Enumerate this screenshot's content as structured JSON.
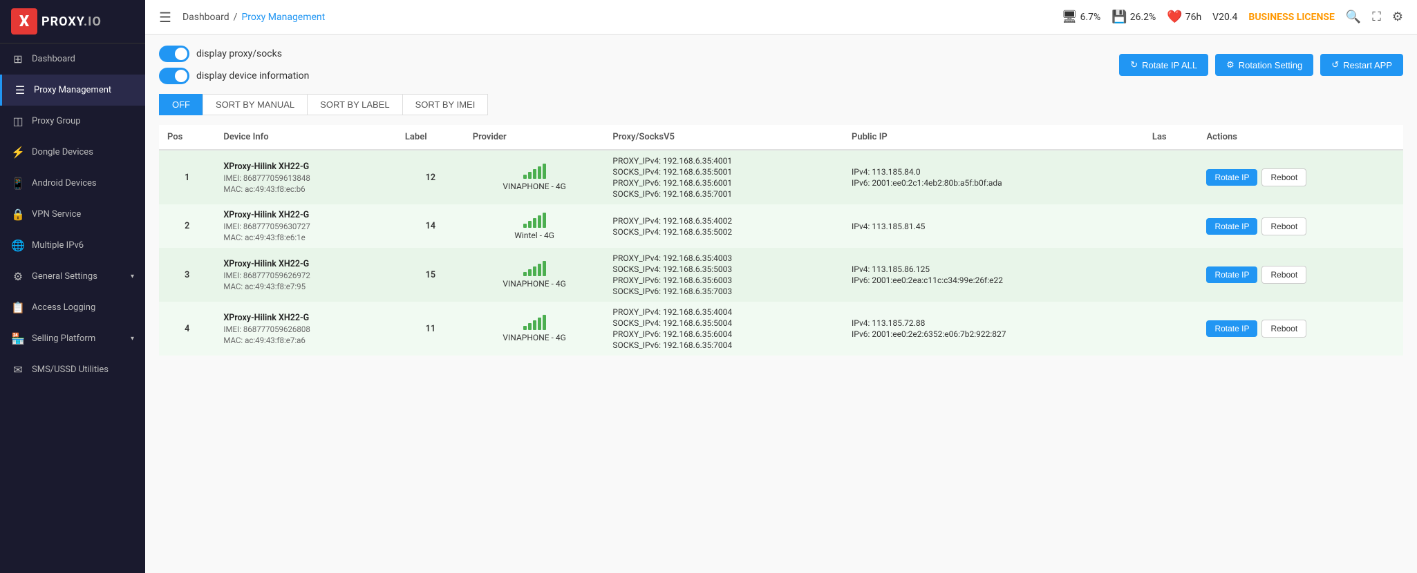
{
  "sidebar": {
    "logo": {
      "letter": "X",
      "text": "PROXY",
      "suffix": ".IO"
    },
    "items": [
      {
        "id": "dashboard",
        "icon": "⊞",
        "label": "Dashboard",
        "active": false
      },
      {
        "id": "proxy-management",
        "icon": "☰",
        "label": "Proxy Management",
        "active": true
      },
      {
        "id": "proxy-group",
        "icon": "◫",
        "label": "Proxy Group",
        "active": false
      },
      {
        "id": "dongle-devices",
        "icon": "⚡",
        "label": "Dongle Devices",
        "active": false
      },
      {
        "id": "android-devices",
        "icon": "📱",
        "label": "Android Devices",
        "active": false
      },
      {
        "id": "vpn-service",
        "icon": "🔒",
        "label": "VPN Service",
        "active": false
      },
      {
        "id": "multiple-ipv6",
        "icon": "🌐",
        "label": "Multiple IPv6",
        "active": false
      },
      {
        "id": "general-settings",
        "icon": "⚙",
        "label": "General Settings",
        "active": false,
        "hasChevron": true
      },
      {
        "id": "access-logging",
        "icon": "📋",
        "label": "Access Logging",
        "active": false
      },
      {
        "id": "selling-platform",
        "icon": "🏪",
        "label": "Selling Platform",
        "active": false,
        "hasChevron": true
      },
      {
        "id": "sms-ussd",
        "icon": "✉",
        "label": "SMS/USSD Utilities",
        "active": false
      }
    ]
  },
  "topbar": {
    "menu_icon": "☰",
    "breadcrumb": {
      "parent": "Dashboard",
      "separator": "/",
      "current": "Proxy Management"
    },
    "stats": {
      "cpu_icon": "🖥",
      "cpu_value": "6.7%",
      "ram_icon": "💾",
      "ram_value": "26.2%",
      "heart_icon": "❤",
      "uptime": "76h",
      "version": "V20.4"
    },
    "license": "BUSINESS LICENSE",
    "icons": {
      "search": "🔍",
      "expand": "⛶",
      "settings": "⚙"
    }
  },
  "controls": {
    "toggle1_label": "display proxy/socks",
    "toggle2_label": "display device information",
    "buttons": {
      "rotate_all": "Rotate IP ALL",
      "rotation_setting": "Rotation Setting",
      "restart_app": "Restart APP"
    }
  },
  "sort_tabs": [
    {
      "id": "off",
      "label": "OFF",
      "active": true
    },
    {
      "id": "manual",
      "label": "SORT BY MANUAL",
      "active": false
    },
    {
      "id": "label",
      "label": "SORT BY LABEL",
      "active": false
    },
    {
      "id": "imei",
      "label": "SORT BY IMEI",
      "active": false
    }
  ],
  "table": {
    "headers": [
      "Pos",
      "Device Info",
      "Label",
      "Provider",
      "Proxy/SocksV5",
      "Public IP",
      "Las",
      "Actions"
    ],
    "rows": [
      {
        "pos": "1",
        "device_name": "XProxy-Hilink XH22-G",
        "imei": "IMEI: 868777059613848",
        "mac": "MAC: ac:49:43:f8:ec:b6",
        "label": "12",
        "provider": "VINAPHONE - 4G",
        "proxies": [
          "PROXY_IPv4: 192.168.6.35:4001",
          "SOCKS_IPv4: 192.168.6.35:5001",
          "PROXY_IPv6: 192.168.6.35:6001",
          "SOCKS_IPv6: 192.168.6.35:7001"
        ],
        "ipv4": "IPv4: 113.185.84.0",
        "ipv6": "IPv6: 2001:ee0:2c1:4eb2:80b:a5f:b0f:ada",
        "btn_rotate": "Rotate IP",
        "btn_reboot": "Reboot"
      },
      {
        "pos": "2",
        "device_name": "XProxy-Hilink XH22-G",
        "imei": "IMEI: 868777059630727",
        "mac": "MAC: ac:49:43:f8:e6:1e",
        "label": "14",
        "provider": "Wintel - 4G",
        "proxies": [
          "PROXY_IPv4: 192.168.6.35:4002",
          "SOCKS_IPv4: 192.168.6.35:5002"
        ],
        "ipv4": "IPv4: 113.185.81.45",
        "ipv6": "",
        "btn_rotate": "Rotate IP",
        "btn_reboot": "Reboot"
      },
      {
        "pos": "3",
        "device_name": "XProxy-Hilink XH22-G",
        "imei": "IMEI: 868777059626972",
        "mac": "MAC: ac:49:43:f8:e7:95",
        "label": "15",
        "provider": "VINAPHONE - 4G",
        "proxies": [
          "PROXY_IPv4: 192.168.6.35:4003",
          "SOCKS_IPv4: 192.168.6.35:5003",
          "PROXY_IPv6: 192.168.6.35:6003",
          "SOCKS_IPv6: 192.168.6.35:7003"
        ],
        "ipv4": "IPv4: 113.185.86.125",
        "ipv6": "IPv6: 2001:ee0:2ea:c11c:c34:99e:26f:e22",
        "btn_rotate": "Rotate IP",
        "btn_reboot": "Reboot"
      },
      {
        "pos": "4",
        "device_name": "XProxy-Hilink XH22-G",
        "imei": "IMEI: 868777059626808",
        "mac": "MAC: ac:49:43:f8:e7:a6",
        "label": "11",
        "provider": "VINAPHONE - 4G",
        "proxies": [
          "PROXY_IPv4: 192.168.6.35:4004",
          "SOCKS_IPv4: 192.168.6.35:5004",
          "PROXY_IPv6: 192.168.6.35:6004",
          "SOCKS_IPv6: 192.168.6.35:7004"
        ],
        "ipv4": "IPv4: 113.185.72.88",
        "ipv6": "IPv6: 2001:ee0:2e2:6352:e06:7b2:922:827",
        "btn_rotate": "Rotate IP",
        "btn_reboot": "Reboot"
      }
    ]
  }
}
